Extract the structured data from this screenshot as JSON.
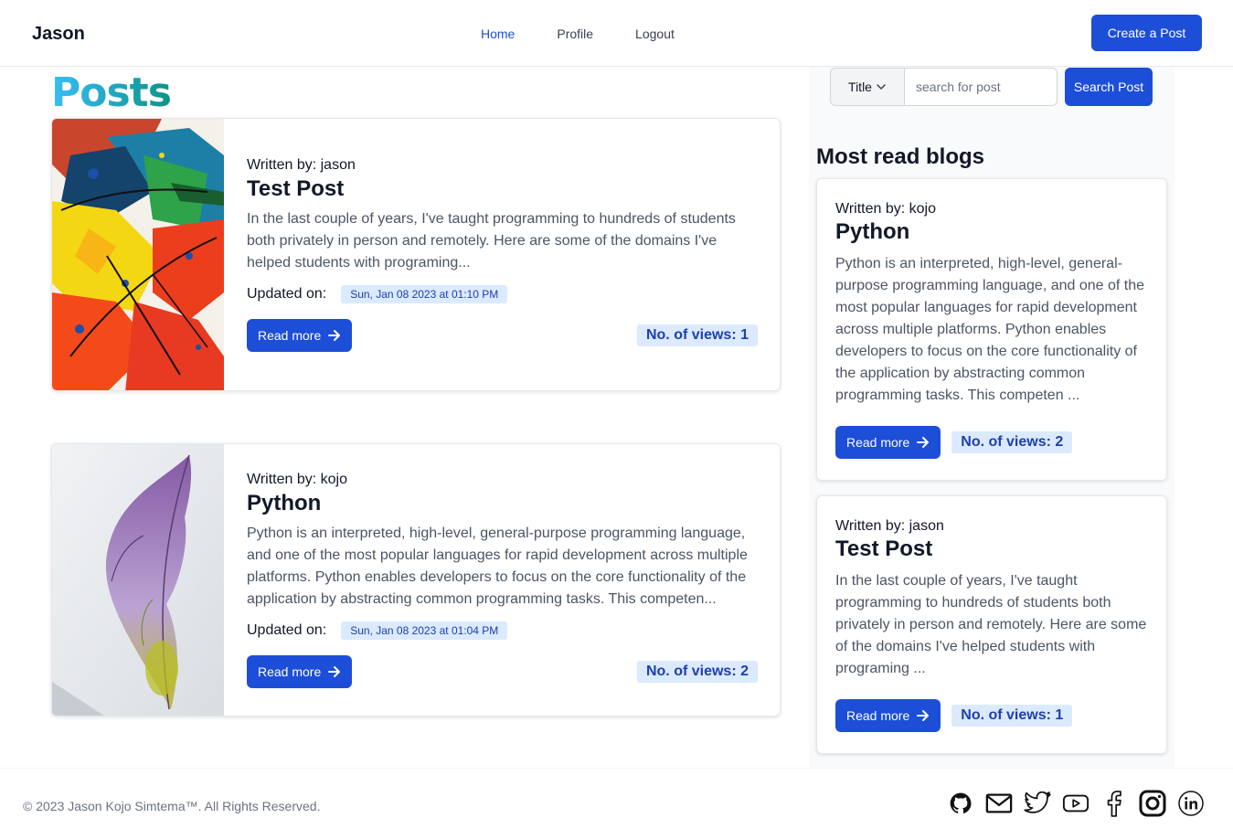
{
  "navbar": {
    "brand": "Jason",
    "links": [
      {
        "label": "Home",
        "active": true
      },
      {
        "label": "Profile",
        "active": false
      },
      {
        "label": "Logout",
        "active": false
      }
    ],
    "create_button": "Create a Post"
  },
  "main": {
    "heading": "Posts",
    "posts": [
      {
        "author": "Written by: jason",
        "title": "Test Post",
        "excerpt": "In the last couple of years, I've taught programming to hundreds of students both privately in person and remotely. Here are some of the domains I've helped students with programing...",
        "updated_label": "Updated on:",
        "updated_date": "Sun, Jan 08 2023 at 01:10 PM",
        "read_more": "Read more",
        "views": "No. of views: 1",
        "image": "abstract-paint-image"
      },
      {
        "author": "Written by: kojo",
        "title": "Python",
        "excerpt": "Python is an interpreted, high-level, general-purpose programming language, and one of the most popular languages for rapid development across multiple platforms. Python enables developers to focus on the core functionality of the application by abstracting common programming tasks. This competen...",
        "updated_label": "Updated on:",
        "updated_date": "Sun, Jan 08 2023 at 01:04 PM",
        "read_more": "Read more",
        "views": "No. of views: 2",
        "image": "feather-image"
      }
    ]
  },
  "sidebar": {
    "search": {
      "select_value": "Title",
      "placeholder": "search for post",
      "button": "Search Post"
    },
    "most_read_title": "Most read blogs",
    "cards": [
      {
        "author": "Written by: kojo",
        "title": "Python",
        "excerpt": "Python is an interpreted, high-level, general-purpose programming language, and one of the most popular languages for rapid development across multiple platforms. Python enables developers to focus on the core functionality of the application by abstracting common programming tasks. This competen ...",
        "read_more": "Read more",
        "views": "No. of views: 2"
      },
      {
        "author": "Written by: jason",
        "title": "Test Post",
        "excerpt": "In the last couple of years, I've taught programming to hundreds of students both privately in person and remotely. Here are some of the domains I've helped students with programing ...",
        "read_more": "Read more",
        "views": "No. of views: 1"
      }
    ]
  },
  "footer": {
    "copyright": "© 2023 Jason Kojo Simtema™. All Rights Reserved.",
    "socials": [
      "github-icon",
      "mail-icon",
      "twitter-icon",
      "youtube-icon",
      "facebook-icon",
      "instagram-icon",
      "linkedin-icon"
    ]
  },
  "colors": {
    "primary": "#1d4ed8",
    "badge_bg": "#dbeafe",
    "badge_text": "#1e40af",
    "heading_gradient_start": "#38bdf8",
    "heading_gradient_end": "#0d9488"
  }
}
